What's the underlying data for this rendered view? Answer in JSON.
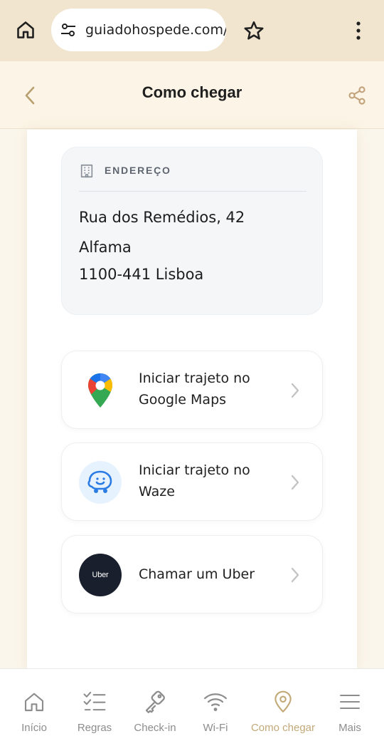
{
  "browser": {
    "url": "guiadohospede.com/p",
    "icons": [
      "home-icon",
      "site-settings-icon",
      "star-icon",
      "more-vert-icon"
    ]
  },
  "header": {
    "title": "Como chegar",
    "icons": [
      "back-chevron-icon",
      "share-icon"
    ],
    "background": "#fcf4e6"
  },
  "address": {
    "label": "ENDEREÇO",
    "line1": "Rua dos Remédios, 42",
    "line2": "Alfama",
    "line3": "1100-441 Lisboa",
    "icon": "building-icon"
  },
  "actions": [
    {
      "id": "google-maps",
      "line1": "Iniciar trajeto no",
      "line2": "Google Maps",
      "icon": "google-maps-pin-icon"
    },
    {
      "id": "waze",
      "line1": "Iniciar trajeto no",
      "line2": "Waze",
      "icon": "waze-icon"
    },
    {
      "id": "uber",
      "line1": "Chamar um Uber",
      "badge_text": "Uber",
      "icon": "uber-logo-icon"
    }
  ],
  "nav": {
    "items": [
      {
        "label": "Início",
        "icon": "home-icon"
      },
      {
        "label": "Regras",
        "icon": "checklist-icon"
      },
      {
        "label": "Check-in",
        "icon": "key-icon"
      },
      {
        "label": "Wi-Fi",
        "icon": "wifi-icon"
      },
      {
        "label": "Como chegar",
        "icon": "location-pin-icon",
        "active": true
      },
      {
        "label": "Mais",
        "icon": "menu-icon"
      }
    ]
  },
  "colors": {
    "accent": "#c2a978",
    "browser_bar": "#f1e5cf",
    "page_bg": "#fbf6ec",
    "uber_badge": "#1a1f2e",
    "waze_bg": "#e6f2fd"
  }
}
